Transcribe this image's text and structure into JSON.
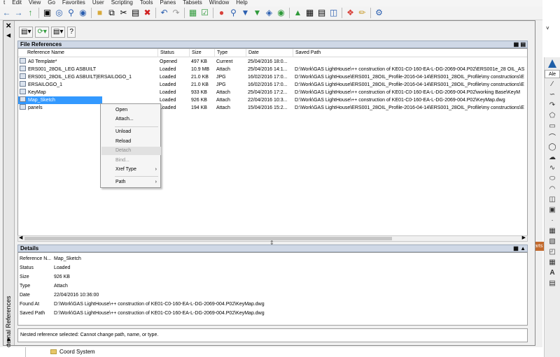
{
  "menubar": [
    "t",
    "Edit",
    "View",
    "Go",
    "Favorites",
    "User",
    "Scripting",
    "Tools",
    "Panes",
    "Tabsets",
    "Window",
    "Help"
  ],
  "palette": {
    "title": "External References"
  },
  "file_references": {
    "title": "File References",
    "columns": [
      "Reference Name",
      "Status",
      "Size",
      "Type",
      "Date",
      "Saved Path"
    ],
    "rows": [
      {
        "name": "A0 Template*",
        "status": "Opened",
        "size": "497 KB",
        "type": "Current",
        "date": "25/04/2016 18:0...",
        "path": ""
      },
      {
        "name": "ERS001_28OIL_LEG ASBUILT",
        "status": "Loaded",
        "size": "10.9 MB",
        "type": "Attach",
        "date": "25/04/2016 14:1...",
        "path": "D:\\Work\\GAS LightHouse\\++ construction of KE01-C0-160-EA-L-DG-2069-004.P02\\ERS001e_28 OIL_AS"
      },
      {
        "name": "ERS001_28OIL_LEG ASBUILT|ERSAILOGO_1",
        "status": "Loaded",
        "size": "21.0 KB",
        "type": "JPG",
        "date": "16/02/2016 17:0...",
        "path": "D:\\Work\\GAS LightHouse\\ERS001_28OIL_Profile-2016-04-14\\ERS001_28OIL_Profile\\my constructions\\E"
      },
      {
        "name": "ERSAILOGO_1",
        "status": "Loaded",
        "size": "21.0 KB",
        "type": "JPG",
        "date": "16/02/2016 17:0...",
        "path": "D:\\Work\\GAS LightHouse\\ERS001_28OIL_Profile-2016-04-14\\ERS001_28OIL_Profile\\my constructions\\E"
      },
      {
        "name": "KeyMap",
        "status": "Loaded",
        "size": "933 KB",
        "type": "Attach",
        "date": "25/04/2016 17:2...",
        "path": "D:\\Work\\GAS LightHouse\\++ construction of KE01-C0-160-EA-L-DG-2069-004.P02\\working Base\\KeyM"
      },
      {
        "name": "Map_Sketch",
        "status": "Loaded",
        "size": "926 KB",
        "type": "Attach",
        "date": "22/04/2016 10:3...",
        "path": "D:\\Work\\GAS LightHouse\\++ construction of KE01-C0-160-EA-L-DG-2069-004.P02\\KeyMap.dwg"
      },
      {
        "name": "panels",
        "status": "Loaded",
        "size": "194 KB",
        "type": "Attach",
        "date": "15/04/2016 15:2...",
        "path": "D:\\Work\\GAS LightHouse\\ERS001_28OIL_Profile-2016-04-14\\ERS001_28OIL_Profile\\my constructions\\E"
      }
    ]
  },
  "context_menu": {
    "items": [
      {
        "label": "Open",
        "enabled": true
      },
      {
        "label": "Attach...",
        "enabled": true
      },
      {
        "label": "Unload",
        "enabled": true
      },
      {
        "label": "Reload",
        "enabled": true
      },
      {
        "label": "Detach",
        "enabled": false
      },
      {
        "label": "Bind...",
        "enabled": false
      },
      {
        "label": "Xref Type",
        "enabled": true,
        "submenu": true
      },
      {
        "label": "Path",
        "enabled": true,
        "submenu": true
      }
    ]
  },
  "details": {
    "title": "Details",
    "fields": [
      {
        "label": "Reference N...",
        "value": "Map_Sketch"
      },
      {
        "label": "Status",
        "value": "Loaded"
      },
      {
        "label": "Size",
        "value": "926 KB"
      },
      {
        "label": "Type",
        "value": "Attach"
      },
      {
        "label": "Date",
        "value": "22/04/2016 10:36:00"
      },
      {
        "label": "Found At",
        "value": "D:\\Work\\GAS LightHouse\\++ construction of KE01-C0-160-EA-L-DG-2069-004.P02\\KeyMap.dwg"
      },
      {
        "label": "Saved Path",
        "value": "D:\\Work\\GAS LightHouse\\++ construction of KE01-C0-160-EA-L-DG-2069-004.P02\\KeyMap.dwg"
      }
    ]
  },
  "message": "Nested reference selected: Cannot change path, name, or type.",
  "bottom": {
    "folder_label": "Coord System"
  },
  "right_panel": {
    "badge": "arts",
    "tab_label": "Ale"
  }
}
